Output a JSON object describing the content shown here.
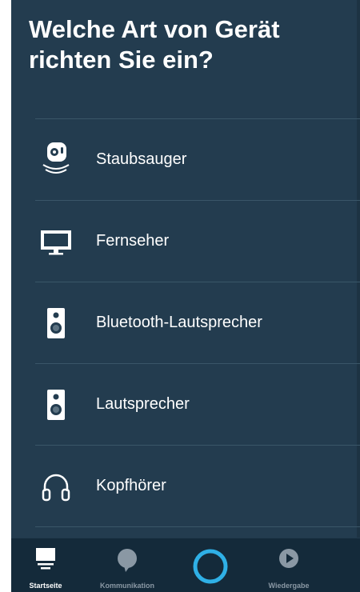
{
  "page": {
    "title_line1": "Welche Art von Gerät",
    "title_line2": "richten Sie ein?"
  },
  "devices": [
    {
      "label": "Staubsauger",
      "icon": "vacuum-robot-icon"
    },
    {
      "label": "Fernseher",
      "icon": "tv-icon"
    },
    {
      "label": "Bluetooth-Lautsprecher",
      "icon": "bluetooth-speaker-icon"
    },
    {
      "label": "Lautsprecher",
      "icon": "speaker-icon"
    },
    {
      "label": "Kopfhörer",
      "icon": "headphones-icon"
    }
  ],
  "nav": {
    "home_label": "Startseite",
    "comm_label": "Kommunikation",
    "play_label": "Wiedergabe",
    "active": "home"
  },
  "colors": {
    "background": "#233c4f",
    "nav_background": "#142a3a",
    "alexa_ring": "#2fb0e6",
    "text": "#ffffff",
    "inactive": "#8a98a4"
  }
}
